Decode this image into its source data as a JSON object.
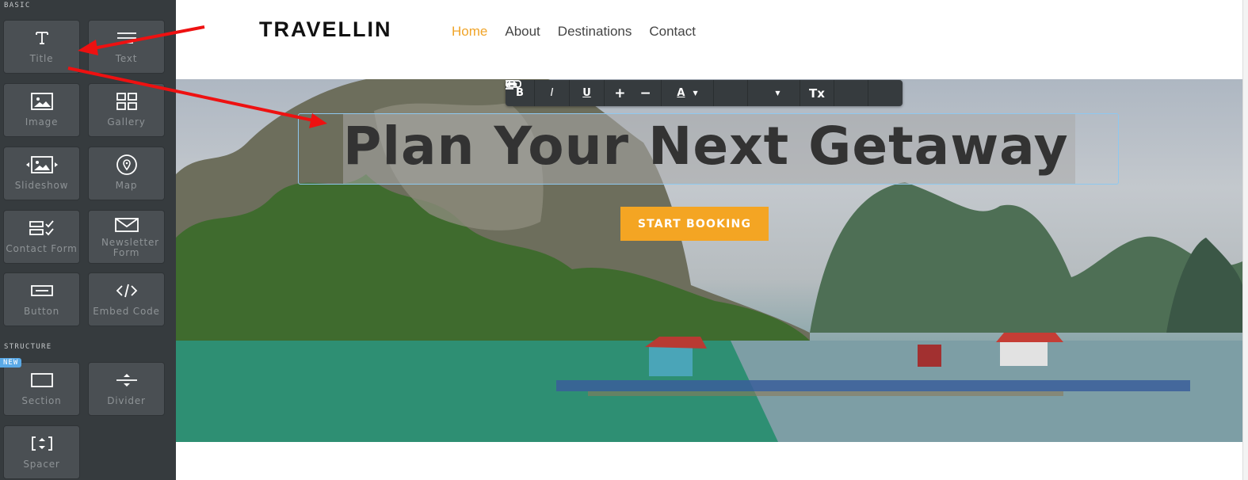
{
  "sidebar": {
    "sections": [
      {
        "label": "BASIC",
        "items": [
          {
            "label": "Title",
            "icon": "title-icon"
          },
          {
            "label": "Text",
            "icon": "text-icon"
          },
          {
            "label": "Image",
            "icon": "image-icon"
          },
          {
            "label": "Gallery",
            "icon": "gallery-icon"
          },
          {
            "label": "Slideshow",
            "icon": "slideshow-icon"
          },
          {
            "label": "Map",
            "icon": "map-pin-icon"
          },
          {
            "label": "Contact Form",
            "icon": "contact-form-icon"
          },
          {
            "label": "Newsletter Form",
            "icon": "envelope-icon"
          },
          {
            "label": "Button",
            "icon": "button-icon"
          },
          {
            "label": "Embed Code",
            "icon": "code-icon"
          }
        ]
      },
      {
        "label": "STRUCTURE",
        "badge": "NEW",
        "items": [
          {
            "label": "Section",
            "icon": "section-icon"
          },
          {
            "label": "Divider",
            "icon": "divider-icon"
          },
          {
            "label": "Spacer",
            "icon": "spacer-icon"
          }
        ]
      }
    ]
  },
  "site": {
    "logo": "TRAVELLIN",
    "nav": [
      {
        "label": "Home",
        "active": true
      },
      {
        "label": "About"
      },
      {
        "label": "Destinations"
      },
      {
        "label": "Contact"
      }
    ],
    "accent_color": "#f4a523",
    "hero": {
      "title": "Plan Your Next Getaway",
      "cta_label": "START BOOKING"
    }
  },
  "toolbar": {
    "buttons": [
      {
        "label": "B",
        "icon": "bold-icon"
      },
      {
        "label": "I",
        "icon": "italic-icon"
      },
      {
        "label": "U",
        "icon": "underline-icon"
      },
      {
        "label": "+",
        "icon": "increase-size-icon"
      },
      {
        "label": "−",
        "icon": "decrease-size-icon"
      },
      {
        "label": "A",
        "icon": "text-color-icon"
      },
      {
        "label": "",
        "icon": "link-icon"
      },
      {
        "label": "",
        "icon": "align-icon"
      },
      {
        "label": "Tx",
        "icon": "clear-format-icon"
      },
      {
        "label": "",
        "icon": "undo-icon"
      },
      {
        "label": "",
        "icon": "redo-icon"
      }
    ]
  }
}
